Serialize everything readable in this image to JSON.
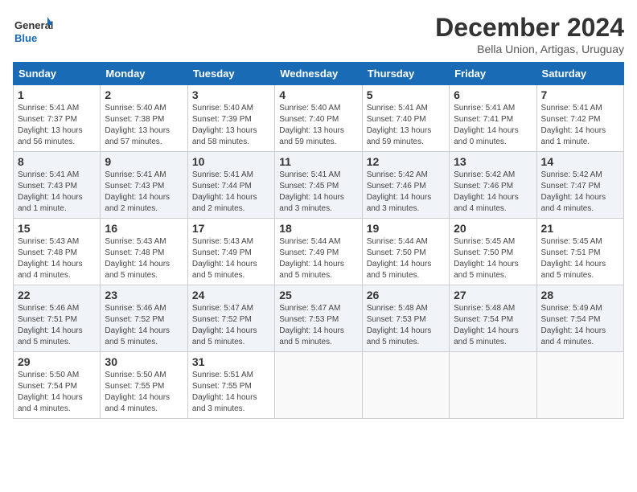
{
  "header": {
    "logo_line1": "General",
    "logo_line2": "Blue",
    "month_title": "December 2024",
    "subtitle": "Bella Union, Artigas, Uruguay"
  },
  "days_of_week": [
    "Sunday",
    "Monday",
    "Tuesday",
    "Wednesday",
    "Thursday",
    "Friday",
    "Saturday"
  ],
  "weeks": [
    [
      {
        "day": 1,
        "sunrise": "5:41 AM",
        "sunset": "7:37 PM",
        "daylight": "13 hours and 56 minutes."
      },
      {
        "day": 2,
        "sunrise": "5:40 AM",
        "sunset": "7:38 PM",
        "daylight": "13 hours and 57 minutes."
      },
      {
        "day": 3,
        "sunrise": "5:40 AM",
        "sunset": "7:39 PM",
        "daylight": "13 hours and 58 minutes."
      },
      {
        "day": 4,
        "sunrise": "5:40 AM",
        "sunset": "7:40 PM",
        "daylight": "13 hours and 59 minutes."
      },
      {
        "day": 5,
        "sunrise": "5:41 AM",
        "sunset": "7:40 PM",
        "daylight": "13 hours and 59 minutes."
      },
      {
        "day": 6,
        "sunrise": "5:41 AM",
        "sunset": "7:41 PM",
        "daylight": "14 hours and 0 minutes."
      },
      {
        "day": 7,
        "sunrise": "5:41 AM",
        "sunset": "7:42 PM",
        "daylight": "14 hours and 1 minute."
      }
    ],
    [
      {
        "day": 8,
        "sunrise": "5:41 AM",
        "sunset": "7:43 PM",
        "daylight": "14 hours and 1 minute."
      },
      {
        "day": 9,
        "sunrise": "5:41 AM",
        "sunset": "7:43 PM",
        "daylight": "14 hours and 2 minutes."
      },
      {
        "day": 10,
        "sunrise": "5:41 AM",
        "sunset": "7:44 PM",
        "daylight": "14 hours and 2 minutes."
      },
      {
        "day": 11,
        "sunrise": "5:41 AM",
        "sunset": "7:45 PM",
        "daylight": "14 hours and 3 minutes."
      },
      {
        "day": 12,
        "sunrise": "5:42 AM",
        "sunset": "7:46 PM",
        "daylight": "14 hours and 3 minutes."
      },
      {
        "day": 13,
        "sunrise": "5:42 AM",
        "sunset": "7:46 PM",
        "daylight": "14 hours and 4 minutes."
      },
      {
        "day": 14,
        "sunrise": "5:42 AM",
        "sunset": "7:47 PM",
        "daylight": "14 hours and 4 minutes."
      }
    ],
    [
      {
        "day": 15,
        "sunrise": "5:43 AM",
        "sunset": "7:48 PM",
        "daylight": "14 hours and 4 minutes."
      },
      {
        "day": 16,
        "sunrise": "5:43 AM",
        "sunset": "7:48 PM",
        "daylight": "14 hours and 5 minutes."
      },
      {
        "day": 17,
        "sunrise": "5:43 AM",
        "sunset": "7:49 PM",
        "daylight": "14 hours and 5 minutes."
      },
      {
        "day": 18,
        "sunrise": "5:44 AM",
        "sunset": "7:49 PM",
        "daylight": "14 hours and 5 minutes."
      },
      {
        "day": 19,
        "sunrise": "5:44 AM",
        "sunset": "7:50 PM",
        "daylight": "14 hours and 5 minutes."
      },
      {
        "day": 20,
        "sunrise": "5:45 AM",
        "sunset": "7:50 PM",
        "daylight": "14 hours and 5 minutes."
      },
      {
        "day": 21,
        "sunrise": "5:45 AM",
        "sunset": "7:51 PM",
        "daylight": "14 hours and 5 minutes."
      }
    ],
    [
      {
        "day": 22,
        "sunrise": "5:46 AM",
        "sunset": "7:51 PM",
        "daylight": "14 hours and 5 minutes."
      },
      {
        "day": 23,
        "sunrise": "5:46 AM",
        "sunset": "7:52 PM",
        "daylight": "14 hours and 5 minutes."
      },
      {
        "day": 24,
        "sunrise": "5:47 AM",
        "sunset": "7:52 PM",
        "daylight": "14 hours and 5 minutes."
      },
      {
        "day": 25,
        "sunrise": "5:47 AM",
        "sunset": "7:53 PM",
        "daylight": "14 hours and 5 minutes."
      },
      {
        "day": 26,
        "sunrise": "5:48 AM",
        "sunset": "7:53 PM",
        "daylight": "14 hours and 5 minutes."
      },
      {
        "day": 27,
        "sunrise": "5:48 AM",
        "sunset": "7:54 PM",
        "daylight": "14 hours and 5 minutes."
      },
      {
        "day": 28,
        "sunrise": "5:49 AM",
        "sunset": "7:54 PM",
        "daylight": "14 hours and 4 minutes."
      }
    ],
    [
      {
        "day": 29,
        "sunrise": "5:50 AM",
        "sunset": "7:54 PM",
        "daylight": "14 hours and 4 minutes."
      },
      {
        "day": 30,
        "sunrise": "5:50 AM",
        "sunset": "7:55 PM",
        "daylight": "14 hours and 4 minutes."
      },
      {
        "day": 31,
        "sunrise": "5:51 AM",
        "sunset": "7:55 PM",
        "daylight": "14 hours and 3 minutes."
      },
      null,
      null,
      null,
      null
    ]
  ]
}
